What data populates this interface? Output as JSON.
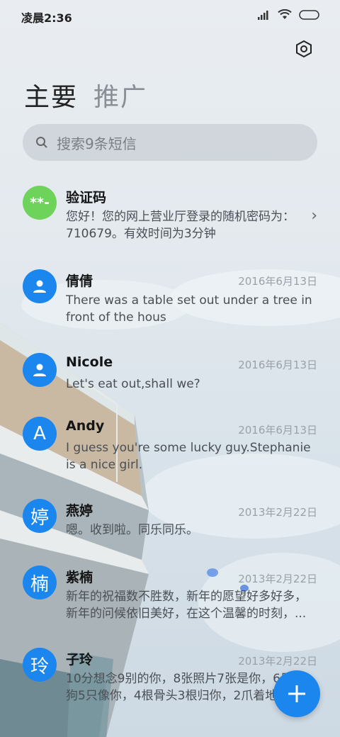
{
  "status_bar": {
    "time": "凌晨2:36"
  },
  "header": {
    "tabs": [
      {
        "label": "主要"
      },
      {
        "label": "推广"
      }
    ],
    "settings_icon": "settings-icon"
  },
  "search": {
    "placeholder": "搜索9条短信"
  },
  "conversations": [
    {
      "name": "验证码",
      "avatar_text": "**-",
      "avatar_color": "#6dd35a",
      "message": "您好！您的网上营业厅登录的随机密码为：710679。有效时间为3分钟",
      "date": ""
    },
    {
      "name": "倩倩",
      "avatar_icon": "person-icon",
      "avatar_color": "#1a86ee",
      "message": "There was a table set out under a tree in front of the hous",
      "date": "2016年6月13日"
    },
    {
      "name": "Nicole",
      "avatar_icon": "person-icon",
      "avatar_color": "#1a86ee",
      "message": "Let's eat out,shall we?",
      "date": "2016年6月13日"
    },
    {
      "name": "Andy",
      "avatar_text": "A",
      "avatar_color": "#1a86ee",
      "message": "I guess you're some lucky guy.Stephanie is a nice girl.",
      "date": "2016年6月13日"
    },
    {
      "name": "燕婷",
      "avatar_text": "婷",
      "avatar_color": "#1a86ee",
      "message": "嗯。收到啦。同乐同乐。",
      "date": "2013年2月22日"
    },
    {
      "name": "紫楠",
      "avatar_text": "楠",
      "avatar_color": "#1a86ee",
      "message": "新年的祝福数不胜数，新年的愿望好多好多，新年的问候依旧美好，在这个温馨的时刻，...",
      "date": "2013年2月22日"
    },
    {
      "name": "子玲",
      "avatar_text": "玲",
      "avatar_color": "#1a86ee",
      "message": "10分想念9别的你，8张照片7张是你，6只小狗5只像你，4根骨头3根归你，2爪着地",
      "date": "2013年2月22日"
    }
  ],
  "fab": {
    "icon": "plus-icon",
    "color": "#1a86ee"
  }
}
